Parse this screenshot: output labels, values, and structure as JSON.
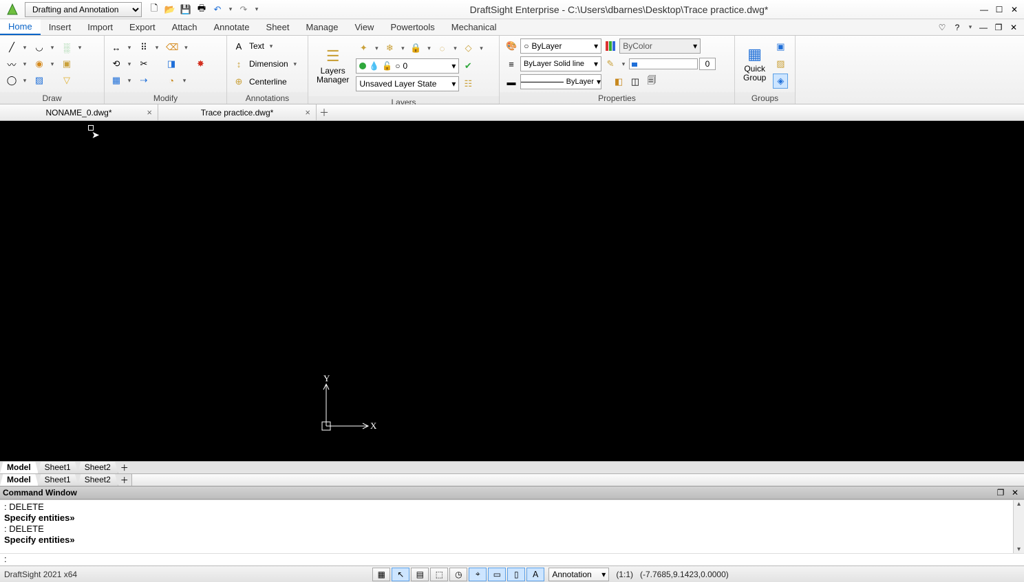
{
  "title": "DraftSight Enterprise - C:\\Users\\dbarnes\\Desktop\\Trace practice.dwg*",
  "workspace": "Drafting and Annotation",
  "menu": {
    "items": [
      "Home",
      "Insert",
      "Import",
      "Export",
      "Attach",
      "Annotate",
      "Sheet",
      "Manage",
      "View",
      "Powertools",
      "Mechanical"
    ],
    "active": "Home"
  },
  "ribbon": {
    "panels": {
      "draw": "Draw",
      "modify": "Modify",
      "annotations": "Annotations",
      "layers": "Layers",
      "properties": "Properties",
      "groups": "Groups"
    },
    "annotations": {
      "text": "Text",
      "dimension": "Dimension",
      "centerline": "Centerline"
    },
    "layers": {
      "manager": "Layers\nManager",
      "active_layer": "0",
      "state": "Unsaved Layer State"
    },
    "properties": {
      "color": "ByLayer",
      "linestyle": "ByLayer   Solid line",
      "lineweight_label": "ByLayer",
      "lineweight_value": "0",
      "bycolor": "ByColor"
    },
    "groups": {
      "quick": "Quick\nGroup"
    }
  },
  "doctabs": [
    {
      "label": "NONAME_0.dwg*"
    },
    {
      "label": "Trace practice.dwg*"
    }
  ],
  "ucs": {
    "x": "X",
    "y": "Y"
  },
  "sheet_tabs_top": [
    "Model",
    "Sheet1",
    "Sheet2"
  ],
  "sheet_tabs_bottom": [
    "Model",
    "Sheet1",
    "Sheet2"
  ],
  "command_window": {
    "title": "Command Window",
    "history": [
      {
        "text": ": DELETE",
        "bold": false
      },
      {
        "text": "Specify entities»",
        "bold": true
      },
      {
        "text": ": DELETE",
        "bold": false
      },
      {
        "text": "Specify entities»",
        "bold": true
      }
    ],
    "prompt": ":"
  },
  "statusbar": {
    "left": "DraftSight 2021 x64",
    "anno": "Annotation",
    "scale": "(1:1)",
    "coords": "(-7.7685,9.1423,0.0000)"
  }
}
